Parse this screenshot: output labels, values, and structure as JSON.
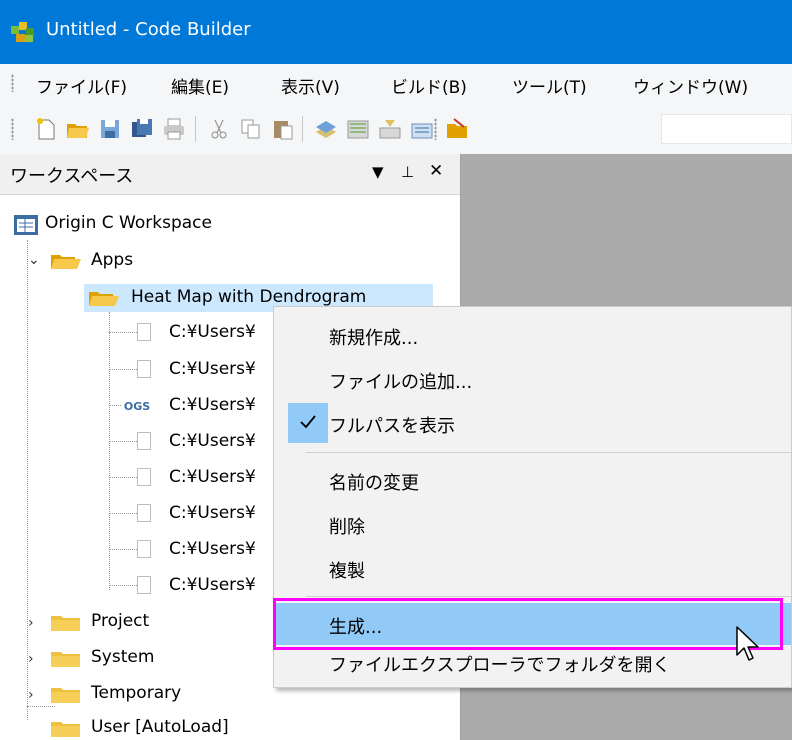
{
  "window": {
    "title": "Untitled - Code Builder"
  },
  "menu": [
    "ファイル(F)",
    "編集(E)",
    "表示(V)",
    "ビルド(B)",
    "ツール(T)",
    "ウィンドウ(W)"
  ],
  "workspace": {
    "title": "ワークスペース",
    "root": "Origin C Workspace",
    "apps_label": "Apps",
    "heatmap_label": "Heat Map with Dendrogram",
    "files": [
      "C:¥Users¥",
      "C:¥Users¥",
      "C:¥Users¥",
      "C:¥Users¥",
      "C:¥Users¥",
      "C:¥Users¥",
      "C:¥Users¥",
      "C:¥Users¥"
    ],
    "ogs_label": "OGS",
    "folders": [
      "Project",
      "System",
      "Temporary",
      "User  [AutoLoad]"
    ]
  },
  "context_menu": {
    "new": "新規作成...",
    "add_files": "ファイルの追加...",
    "show_full_path": "フルパスを表示",
    "rename": "名前の変更",
    "delete": "削除",
    "duplicate": "複製",
    "build": "生成...",
    "open_in_explorer": "ファイルエクスプローラでフォルダを開く"
  },
  "colors": {
    "titlebar": "#0078d7",
    "highlight": "#91c9f7",
    "annotation": "#ff00ff",
    "selection": "#cce8ff",
    "folder": "#f5c542"
  }
}
